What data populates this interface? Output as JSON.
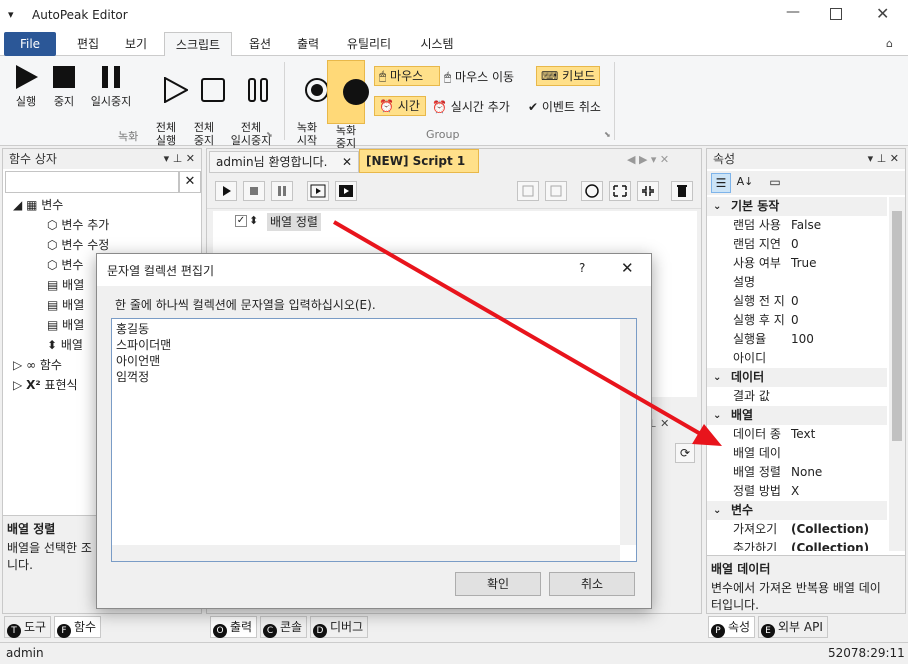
{
  "window": {
    "title": "AutoPeak Editor"
  },
  "ribbon_tabs": [
    "File",
    "편집",
    "보기",
    "스크립트",
    "옵션",
    "출력",
    "유틸리티",
    "시스템"
  ],
  "ribbon": {
    "record_group": {
      "label": "녹화",
      "buttons": [
        "실행",
        "중지",
        "일시중지",
        "전체\n실행",
        "전체\n중지",
        "전체\n일시중지",
        "녹화\n시작",
        "녹화\n중지"
      ]
    },
    "group2": {
      "label": "Group",
      "items": [
        "마우스",
        "마우스 이동",
        "키보드",
        "시간",
        "실시간 추가",
        "이벤트 취소"
      ]
    }
  },
  "left_panel": {
    "title": "함수 상자",
    "search_placeholder": "",
    "tree": {
      "variables": "변수",
      "var_add": "변수 추가",
      "var_edit": "변수 수정",
      "var_3": "변수",
      "arr_1": "배열",
      "arr_2": "배열",
      "arr_3": "배열",
      "arr_4": "배열",
      "functions": "함수",
      "expressions": "표현식"
    },
    "help_title": "배열 정렬",
    "help_text": "배열을 선택한 조\n니다."
  },
  "doc_tabs": [
    "admin님 환영합니다.",
    "[NEW] Script 1"
  ],
  "script": {
    "line_label": "배열 정렬"
  },
  "bottom_tabs_left": [
    "도구",
    "함수"
  ],
  "bottom_tabs_center": [
    "출력",
    "콘솔",
    "디버그"
  ],
  "bottom_tabs_right": [
    "속성",
    "외부 API"
  ],
  "dialog": {
    "title": "문자열 컬렉션 편집기",
    "help": "?",
    "instruction": "한 줄에 하나씩 컬렉션에 문자열을 입력하십시오(E).",
    "lines": [
      "홍길동",
      "스파이더맨",
      "아이언맨",
      "임꺽정"
    ],
    "ok": "확인",
    "cancel": "취소"
  },
  "properties": {
    "title": "속성",
    "categories": [
      {
        "name": "기본 동작",
        "rows": [
          [
            "랜덤 사용",
            "False"
          ],
          [
            "랜덤 지연",
            "0"
          ],
          [
            "사용 여부",
            "True"
          ],
          [
            "설명",
            ""
          ],
          [
            "실행 전 지",
            "0"
          ],
          [
            "실행 후 지",
            "0"
          ],
          [
            "실행율",
            "100"
          ],
          [
            "아이디",
            ""
          ]
        ]
      },
      {
        "name": "데이터",
        "rows": [
          [
            "결과 값",
            ""
          ]
        ]
      },
      {
        "name": "배열",
        "rows": [
          [
            "데이터 종",
            "Text"
          ],
          [
            "배열 데이",
            ""
          ],
          [
            "배열 정렬",
            "None"
          ],
          [
            "정렬 방법",
            "X"
          ]
        ]
      },
      {
        "name": "변수",
        "rows": [
          [
            "가져오기",
            "(Collection)"
          ],
          [
            "추가하기",
            "(Collection)"
          ]
        ]
      }
    ],
    "help_title": "배열 데이터",
    "help_text": "변수에서 가져온 반복용 배열 데이\n터입니다."
  },
  "status": {
    "user": "admin",
    "time": "52078:29:11"
  },
  "colors": {
    "accent": "#2b5797",
    "highlight": "#ffe08a",
    "arrow": "#e8141c"
  }
}
